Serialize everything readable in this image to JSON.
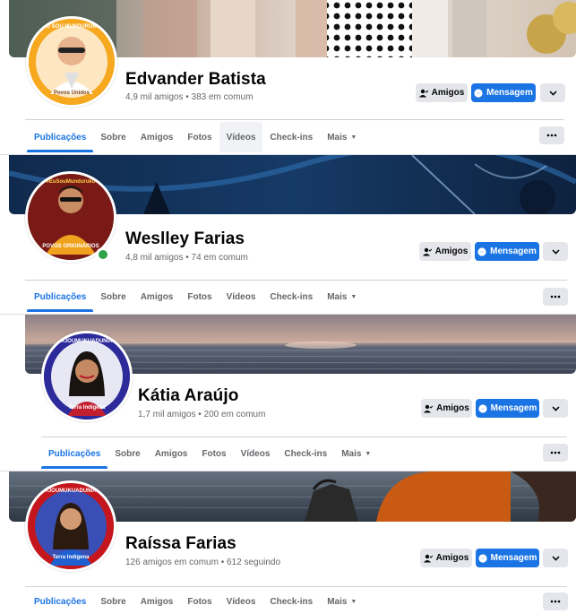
{
  "nav_more_caret": "▼",
  "profiles": [
    {
      "name": "Edvander Batista",
      "meta": "4,9 mil amigos • 383 em comum",
      "avatar_banner": "TU SOU MUNDURUKU",
      "avatar_bottom": "Povos Unidos",
      "friends_label": "Amigos",
      "message_label": "Mensagem",
      "tabs": [
        "Publicações",
        "Sobre",
        "Amigos",
        "Fotos",
        "Vídeos",
        "Check-ins",
        "Mais"
      ]
    },
    {
      "name": "Weslley Farias",
      "meta": "4,8 mil amigos • 74 em comum",
      "avatar_banner": "#EuSouMunduruku",
      "avatar_bottom": "POVOS ORIGINÁRIOS",
      "friends_label": "Amigos",
      "message_label": "Mensagem",
      "tabs": [
        "Publicações",
        "Sobre",
        "Amigos",
        "Fotos",
        "Vídeos",
        "Check-ins",
        "Mais"
      ]
    },
    {
      "name": "Kátia Araújo",
      "meta": "1,7 mil amigos • 200 em comum",
      "avatar_banner": "#JOUMUKUADUNIA",
      "avatar_bottom": "Terra Indígena",
      "friends_label": "Amigos",
      "message_label": "Mensagem",
      "tabs": [
        "Publicações",
        "Sobre",
        "Amigos",
        "Fotos",
        "Vídeos",
        "Check-ins",
        "Mais"
      ]
    },
    {
      "name": "Raíssa Farias",
      "meta": "126 amigos em comum • 612 seguindo",
      "avatar_banner": "#JOUMUKUADUNIA",
      "avatar_bottom": "Terra Indígena",
      "friends_label": "Amigos",
      "message_label": "Mensagem",
      "tabs": [
        "Publicações",
        "Sobre",
        "Amigos",
        "Fotos",
        "Vídeos",
        "Check-ins",
        "Mais"
      ]
    }
  ],
  "colors": {
    "accent": "#1b74e4",
    "gray_button": "#e4e6eb",
    "muted_text": "#65676b",
    "online": "#31a24c"
  }
}
